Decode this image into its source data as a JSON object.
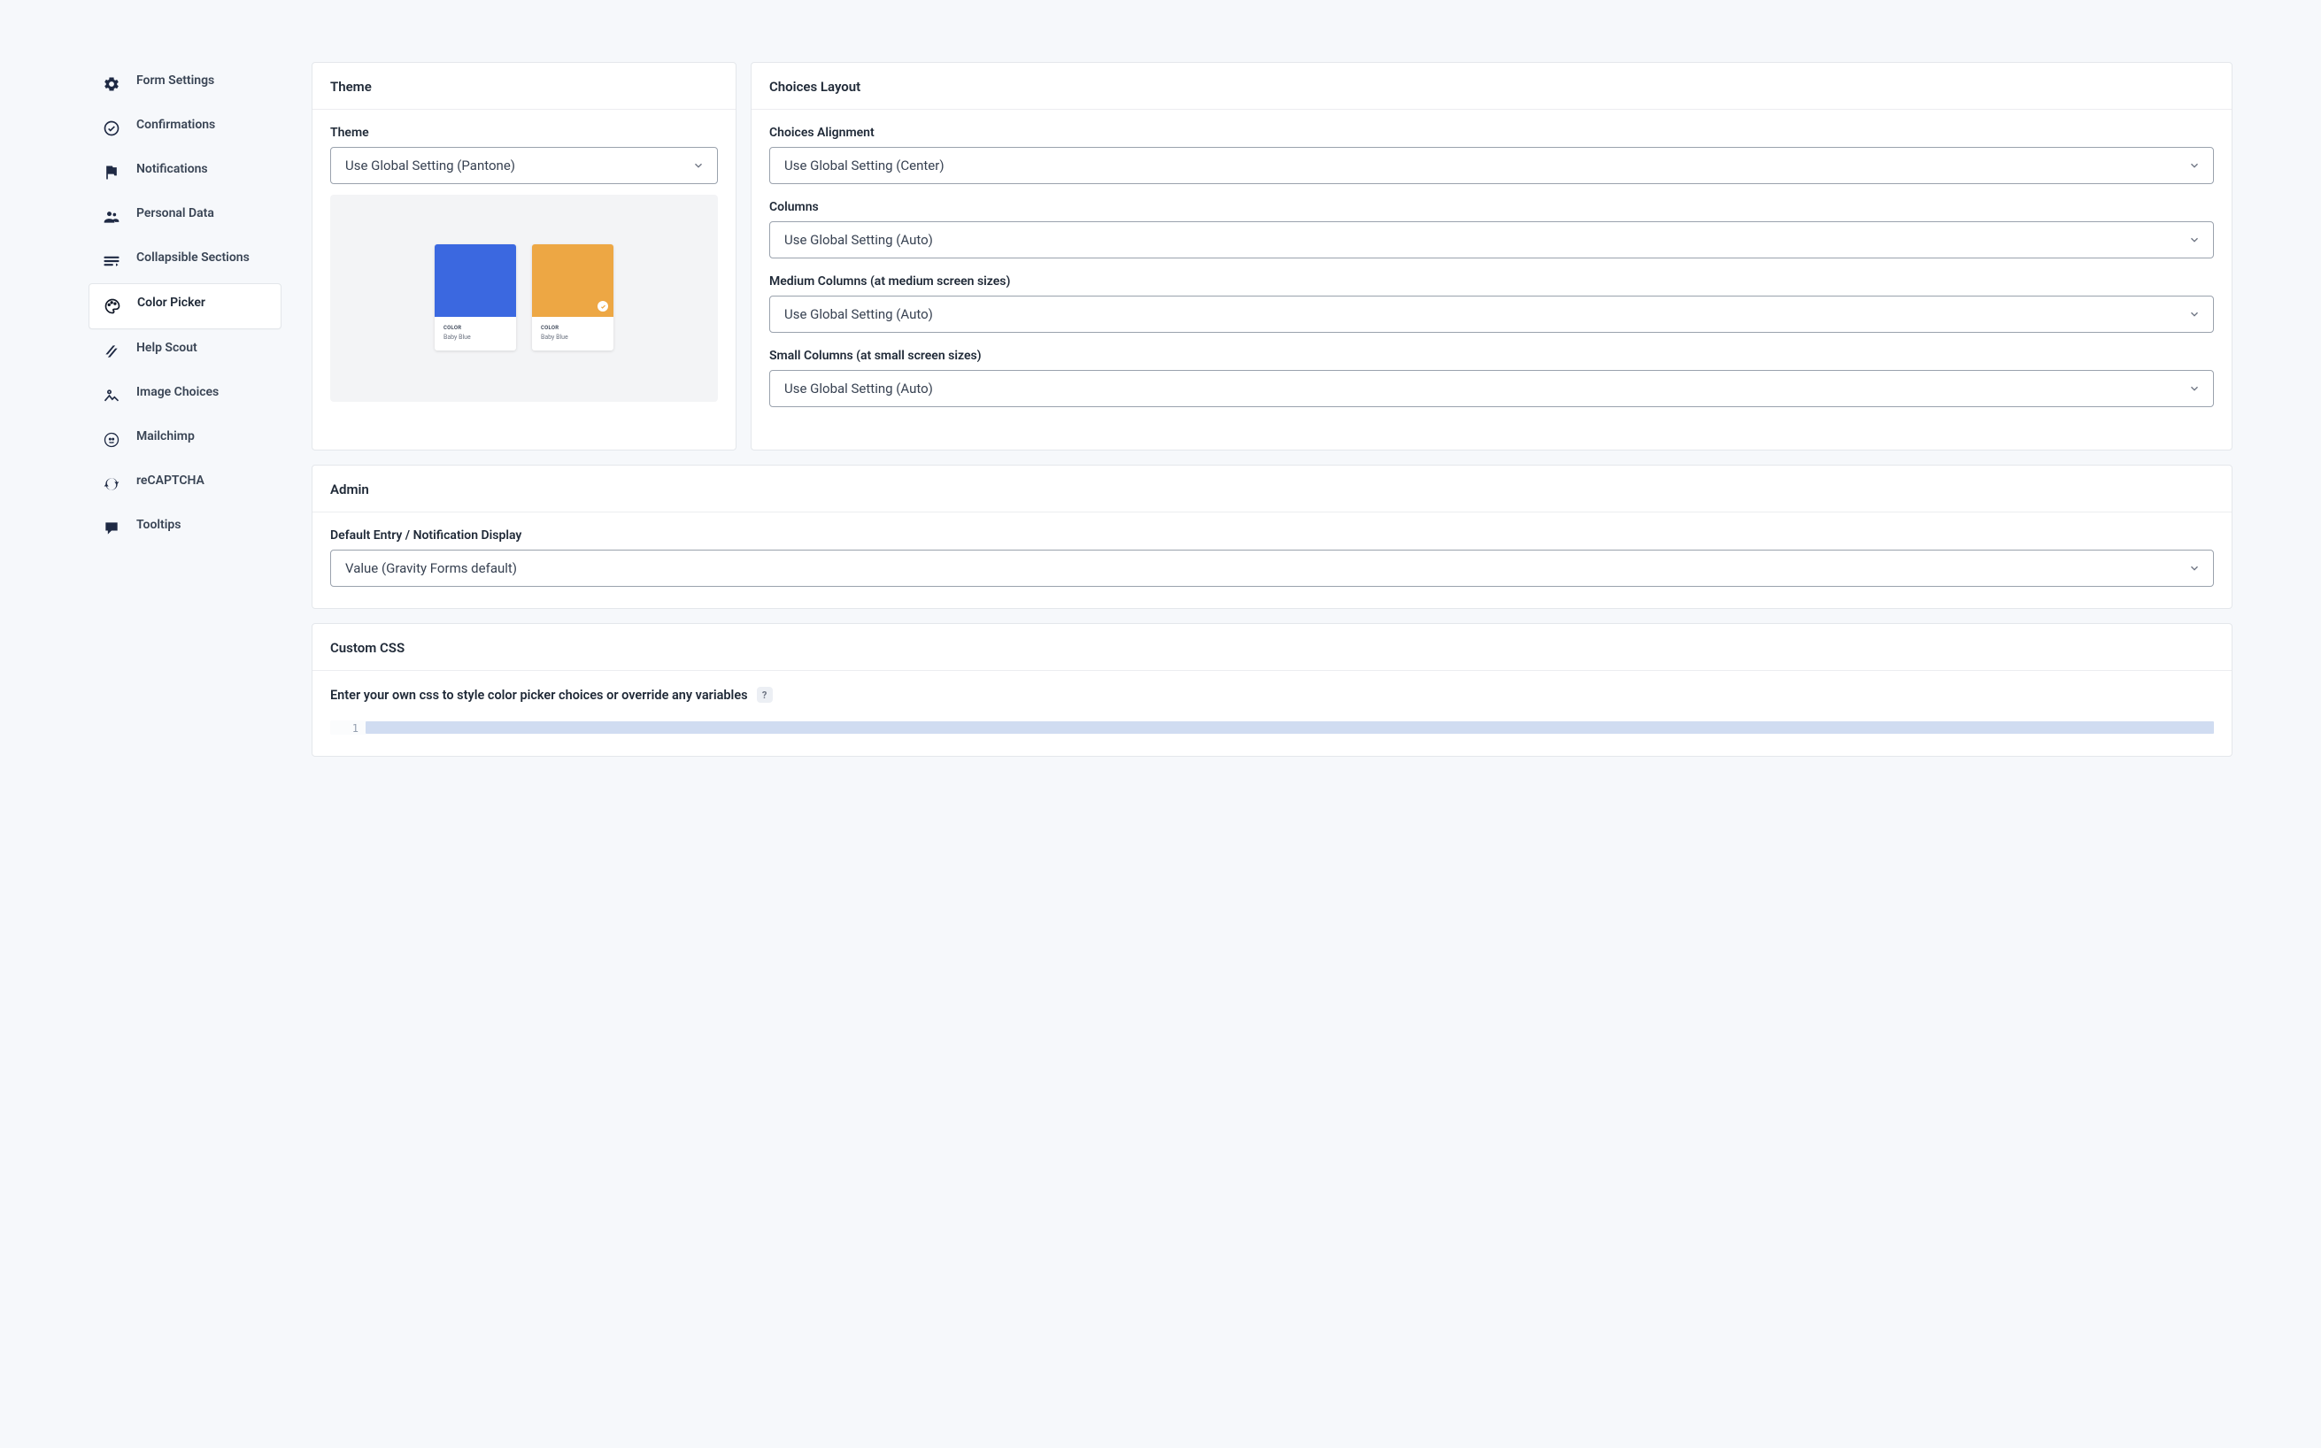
{
  "sidebar": {
    "items": [
      {
        "id": "form-settings",
        "label": "Form Settings",
        "icon": "gear-icon"
      },
      {
        "id": "confirmations",
        "label": "Confirmations",
        "icon": "check-circle-icon"
      },
      {
        "id": "notifications",
        "label": "Notifications",
        "icon": "flag-icon"
      },
      {
        "id": "personal-data",
        "label": "Personal Data",
        "icon": "people-icon"
      },
      {
        "id": "collapsible-sections",
        "label": "Collapsible Sections",
        "icon": "sections-icon"
      },
      {
        "id": "color-picker",
        "label": "Color Picker",
        "icon": "color-picker-icon",
        "active": true
      },
      {
        "id": "help-scout",
        "label": "Help Scout",
        "icon": "stripes-icon"
      },
      {
        "id": "image-choices",
        "label": "Image Choices",
        "icon": "image-icon"
      },
      {
        "id": "mailchimp",
        "label": "Mailchimp",
        "icon": "mailchimp-icon"
      },
      {
        "id": "recaptcha",
        "label": "reCAPTCHA",
        "icon": "recaptcha-icon"
      },
      {
        "id": "tooltips",
        "label": "Tooltips",
        "icon": "comment-icon"
      }
    ]
  },
  "theme_card": {
    "title": "Theme",
    "field_label": "Theme",
    "select_value": "Use Global Setting (Pantone)",
    "swatches": [
      {
        "name": "Baby Blue",
        "category": "COLOR",
        "color": "#3b68e0",
        "selected": false
      },
      {
        "name": "Baby Blue",
        "category": "COLOR",
        "color": "#eda744",
        "selected": true
      }
    ]
  },
  "choices_card": {
    "title": "Choices Layout",
    "fields": [
      {
        "id": "alignment",
        "label": "Choices Alignment",
        "value": "Use Global Setting (Center)"
      },
      {
        "id": "columns",
        "label": "Columns",
        "value": "Use Global Setting (Auto)"
      },
      {
        "id": "medium",
        "label": "Medium Columns (at medium screen sizes)",
        "value": "Use Global Setting (Auto)"
      },
      {
        "id": "small",
        "label": "Small Columns (at small screen sizes)",
        "value": "Use Global Setting (Auto)"
      }
    ]
  },
  "admin_card": {
    "title": "Admin",
    "field_label": "Default Entry / Notification Display",
    "select_value": "Value (Gravity Forms default)"
  },
  "custom_card": {
    "title": "Custom CSS",
    "subtitle": "Enter your own css to style color picker choices or override any variables",
    "help_badge": "?",
    "editor": {
      "first_line_no": "1"
    }
  }
}
